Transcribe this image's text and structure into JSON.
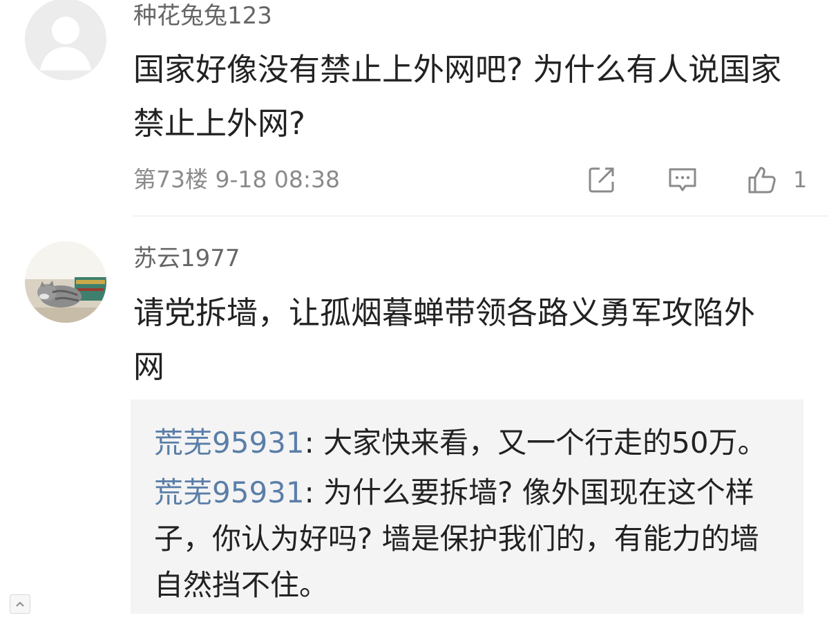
{
  "comments": [
    {
      "username": "种花兔兔123",
      "body": "国家好像没有禁止上外网吧? 为什么有人说国家禁止上外网?",
      "floor": "第73楼",
      "time": "9-18 08:38",
      "likes": "1"
    },
    {
      "username": "苏云1977",
      "body": "请党拆墙，让孤烟暮蝉带领各路义勇军攻陷外网",
      "replies": [
        {
          "user": "荒芜95931",
          "separator": ": ",
          "text": "大家快来看，又一个行走的50万。"
        },
        {
          "user": "荒芜95931",
          "separator": ": ",
          "text": "为什么要拆墙? 像外国现在这个样子，你认为好吗? 墙是保护我们的，有能力的墙自然挡不住。"
        }
      ]
    }
  ],
  "icons": {
    "share": "share-icon",
    "comment": "comment-icon",
    "like": "thumbs-up-icon",
    "scroll_top": "chevron-up-icon"
  },
  "colors": {
    "username": "#666666",
    "meta": "#8a8a8a",
    "reply_user": "#5a7ea8",
    "reply_background": "#f4f4f4"
  }
}
